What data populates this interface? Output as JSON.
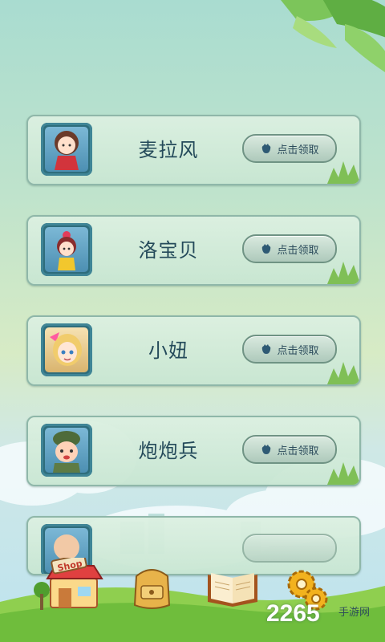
{
  "cards": [
    {
      "name": "麦拉风",
      "claim_label": "点击领取",
      "avatar": "girl-red-dress-avatar"
    },
    {
      "name": "洛宝贝",
      "claim_label": "点击领取",
      "avatar": "girl-pink-bow-avatar"
    },
    {
      "name": "小妞",
      "claim_label": "点击领取",
      "avatar": "blonde-girl-avatar"
    },
    {
      "name": "炮炮兵",
      "claim_label": "点击领取",
      "avatar": "soldier-boy-avatar"
    },
    {
      "name": "",
      "claim_label": "",
      "avatar": "bald-avatar"
    }
  ],
  "nav": {
    "shop_label": "Shop",
    "items": [
      "shop-icon",
      "backpack-icon",
      "book-icon",
      "gears-icon"
    ]
  },
  "watermark": {
    "brand": "2265",
    "suffix": "手游网"
  },
  "colors": {
    "card_border": "#8fb7a9",
    "avatar_frame": "#2e6d7c",
    "text": "#244a5a"
  }
}
